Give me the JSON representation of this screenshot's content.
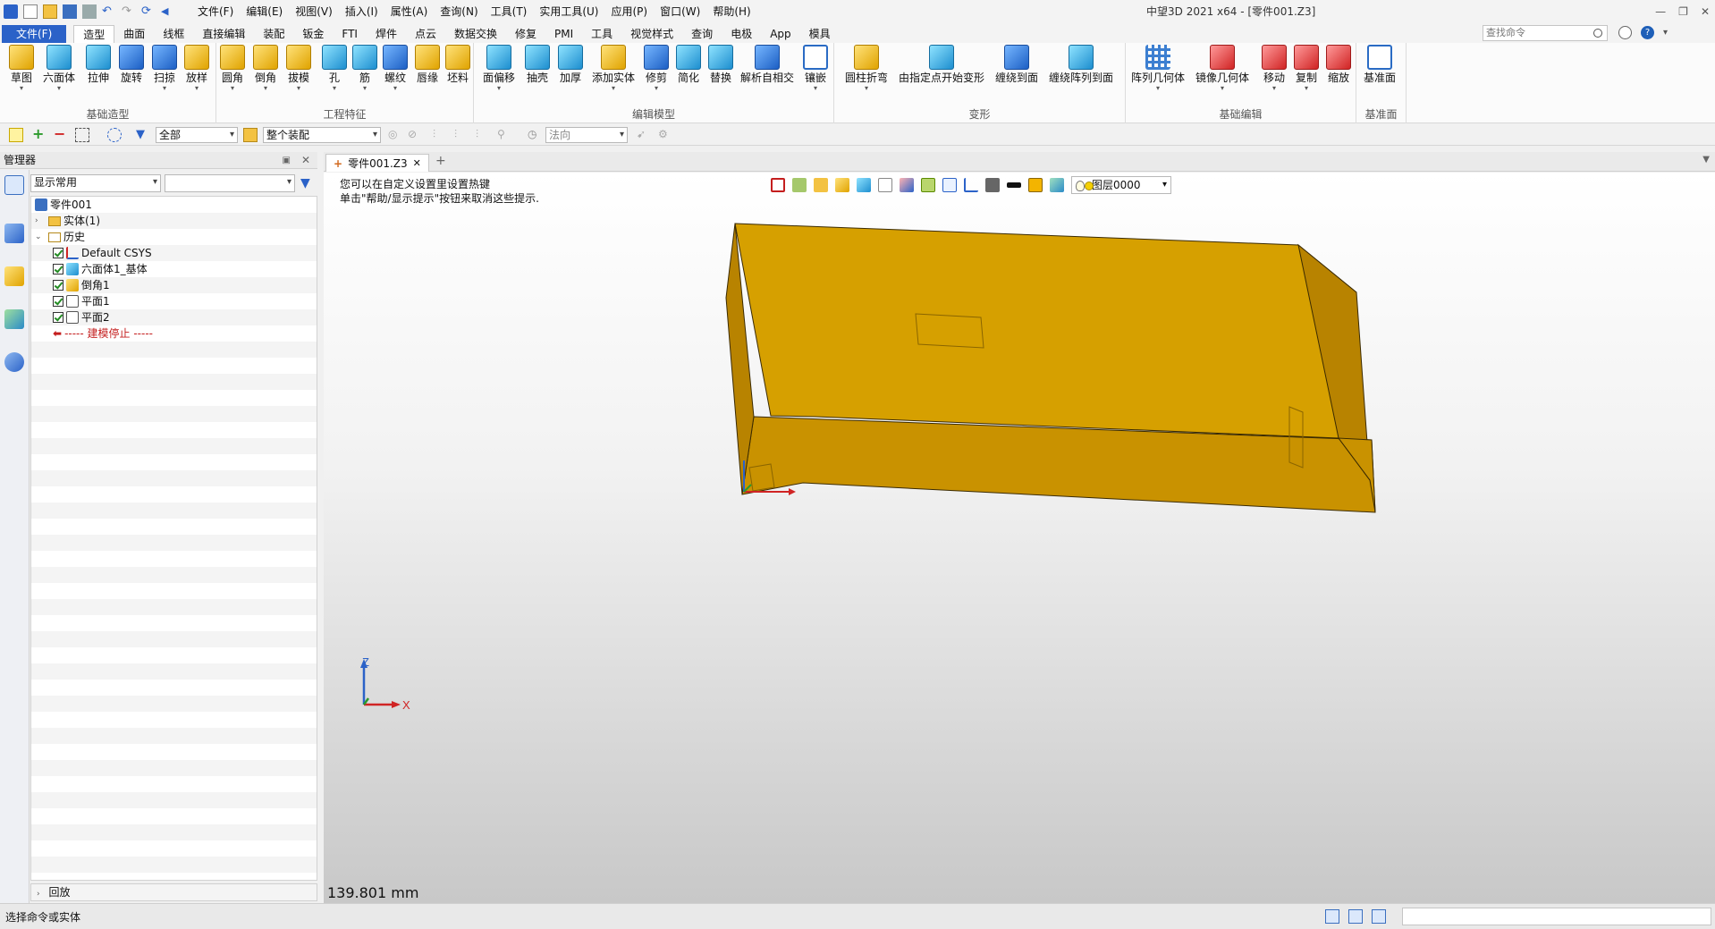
{
  "titlebar": {
    "menu": [
      "文件(F)",
      "编辑(E)",
      "视图(V)",
      "插入(I)",
      "属性(A)",
      "查询(N)",
      "工具(T)",
      "实用工具(U)",
      "应用(P)",
      "窗口(W)",
      "帮助(H)"
    ],
    "window_title": "中望3D 2021 x64 - [零件001.Z3]"
  },
  "ribbon_tabs": {
    "file": "文件(F)",
    "tabs": [
      "造型",
      "曲面",
      "线框",
      "直接编辑",
      "装配",
      "钣金",
      "FTI",
      "焊件",
      "点云",
      "数据交换",
      "修复",
      "PMI",
      "工具",
      "视觉样式",
      "查询",
      "电极",
      "App",
      "模具"
    ],
    "active": "造型",
    "search_placeholder": "查找命令"
  },
  "ribbon": {
    "groups": [
      {
        "name": "基础造型",
        "buttons": [
          "草图",
          "六面体",
          "拉伸",
          "旋转",
          "扫掠",
          "放样"
        ]
      },
      {
        "name": "工程特征",
        "buttons": [
          "圆角",
          "倒角",
          "拔模",
          "孔",
          "筋",
          "螺纹",
          "唇缘",
          "坯料"
        ]
      },
      {
        "name": "编辑模型",
        "buttons": [
          "面偏移",
          "抽壳",
          "加厚",
          "添加实体",
          "修剪",
          "简化",
          "替换",
          "解析自相交",
          "镶嵌"
        ]
      },
      {
        "name": "变形",
        "buttons": [
          "圆柱折弯",
          "由指定点开始变形",
          "缠绕到面",
          "缠绕阵列到面"
        ]
      },
      {
        "name": "基础编辑",
        "buttons": [
          "阵列几何体",
          "镜像几何体",
          "移动",
          "复制",
          "缩放"
        ]
      },
      {
        "name": "基准面",
        "buttons": [
          "基准面"
        ]
      }
    ]
  },
  "toolbar2": {
    "filter": "全部",
    "scope": "整个装配",
    "direction": "法向"
  },
  "manager": {
    "title": "管理器",
    "display_filter": "显示常用",
    "tree": {
      "root": "零件001",
      "solids": "实体(1)",
      "history": "历史",
      "items": [
        "Default CSYS",
        "六面体1_基体",
        "倒角1",
        "平面1",
        "平面2"
      ],
      "stop": "----- 建模停止 -----"
    },
    "rollback": "回放"
  },
  "document": {
    "tab_label": "零件001.Z3",
    "hint_line1": "您可以在自定义设置里设置热键",
    "hint_line2": "单击\"帮助/显示提示\"按钮来取消这些提示.",
    "layer": "图层0000",
    "measure": "139.801 mm",
    "triad": {
      "z": "Z",
      "x": "X"
    }
  },
  "colors": {
    "part_top": "#d6a000",
    "part_front": "#c99200",
    "part_side": "#b88300",
    "edge": "#3a2a00",
    "accent_blue": "#2b62c8"
  },
  "statusbar": {
    "text": "选择命令或实体"
  }
}
